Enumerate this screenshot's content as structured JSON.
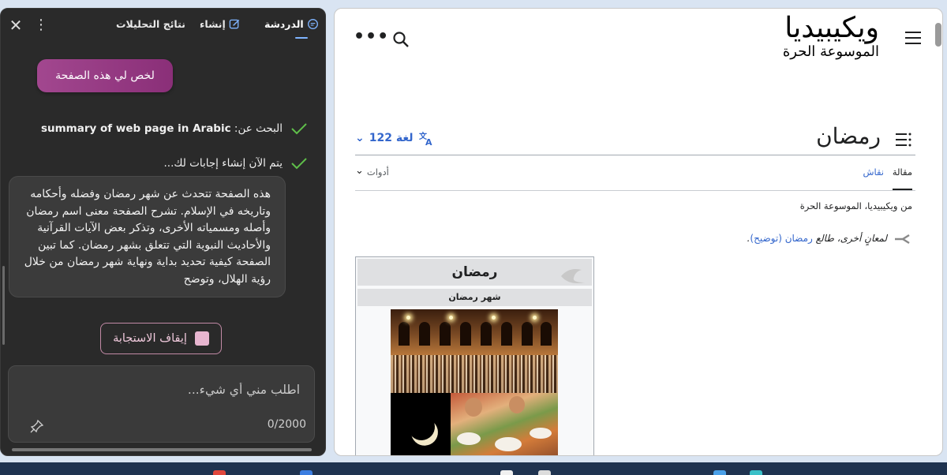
{
  "copilot": {
    "tabs": {
      "chat": "الدردشة",
      "compose": "إنشاء",
      "analytics": "نتائج التحليلات"
    },
    "icons": {
      "close": "close-icon",
      "more": "more-vertical-icon",
      "chat": "chat-icon",
      "compose": "compose-icon"
    },
    "suggestion_chip": "لخص لي هذه الصفحة",
    "steps": [
      {
        "label": "البحث عن:",
        "query": "summary of web page in Arabic"
      },
      {
        "label": "يتم الآن إنشاء إجابات لك..."
      }
    ],
    "answer": "هذه الصفحة تتحدث عن شهر رمضان وفضله وأحكامه وتاريخه في الإسلام. تشرح الصفحة معنى اسم رمضان وأصله ومسمياته الأخرى، وتذكر بعض الآيات القرآنية والأحاديث النبوية التي تتعلق بشهر رمضان. كما تبين الصفحة كيفية تحديد بداية ونهاية شهر رمضان من خلال رؤية الهلال، وتوضح",
    "stop_button": "إيقاف الاستجابة",
    "composer": {
      "placeholder": "اطلب مني أي شيء...",
      "char_count": "0/2000"
    },
    "accent": "#a2478f"
  },
  "wikipedia": {
    "logo_title": "ويكيبيديا",
    "logo_tagline": "الموسوعة الحرة",
    "page_title": "رمضان",
    "languages": "122 لغة",
    "tabs": {
      "article": "مقالة",
      "talk": "نقاش",
      "tools": "أدوات"
    },
    "from_line": "من ويكيبيديا، الموسوعة الحرة",
    "hatnote": {
      "prefix": "لمعانٍ أخرى، طالع",
      "link": "رمضان (توضيح)",
      "suffix": "."
    },
    "infobox": {
      "title": "رمضان",
      "subtitle": "شهر رمضان"
    },
    "link_color": "#3366cc"
  }
}
